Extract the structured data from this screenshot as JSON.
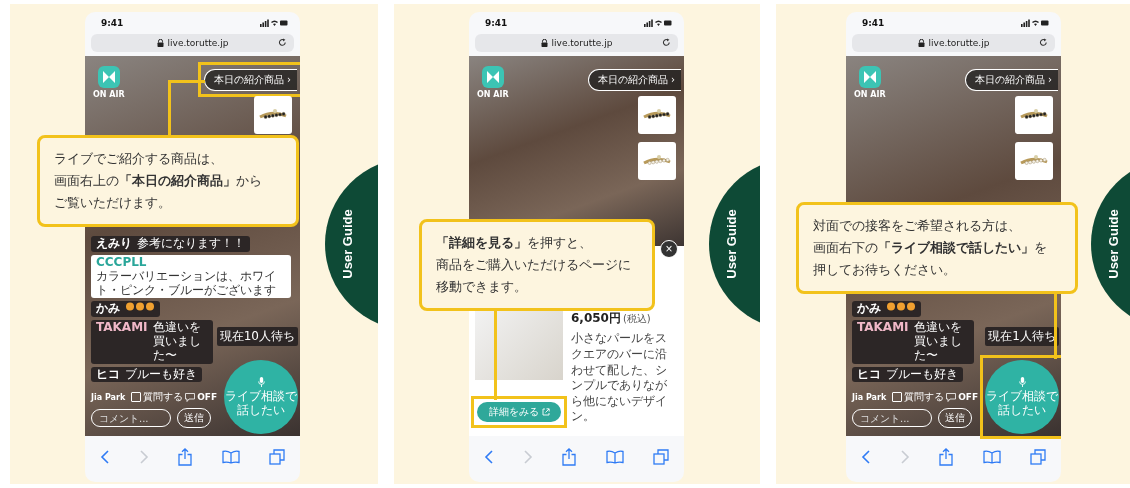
{
  "panels": [
    {
      "kind": "chat",
      "guide_label": "User Guide",
      "callout": [
        "ライブでご紹介する商品は、",
        "画面右上の**「本日の紹介商品」**から",
        "ご覧いただけます。"
      ],
      "phone": {
        "time": "9:41",
        "url": "live.torutte.jp",
        "on_air": "ON AIR",
        "products_button": {
          "label": "本日の紹介商品 ›",
          "highlighted": true
        },
        "thumbnails": [
          {
            "kind": "dark"
          }
        ],
        "messages": [
          {
            "kind": "text",
            "user": "えみり",
            "text": "参考になります！！",
            "pinned": false
          },
          {
            "kind": "text",
            "user": "CCCPLL",
            "text": "カラーバリエーションは、ホワイト・ピンク・ブルーがございます",
            "color": "#2aa69a",
            "pinned": true
          },
          {
            "kind": "reaction",
            "user": "かみ",
            "pinned": false
          },
          {
            "kind": "text",
            "user": "TAKAMI",
            "text": "色違いを買いました〜",
            "color": "#f0b8c8",
            "pinned": false
          },
          {
            "kind": "text",
            "user": "ヒコ",
            "text": "ブルーも好き",
            "pinned": false
          }
        ],
        "waiting": "現在10人待ち",
        "consult_button": {
          "lines": [
            "ライブ相談で",
            "話したい"
          ],
          "highlighted": false
        },
        "viewer": "Jia Park",
        "question_label": "質問する",
        "question_checked": false,
        "comments_toggle": "OFF",
        "comment_placeholder": "コメント...",
        "send_button": "送信"
      }
    },
    {
      "kind": "product",
      "guide_label": "User Guide",
      "callout": [
        "**「詳細を見る」**を押すと、",
        "商品をご購入いただけるページに",
        "移動できます。"
      ],
      "phone": {
        "time": "9:41",
        "url": "live.torutte.jp",
        "on_air": "ON AIR",
        "products_button": {
          "label": "本日の紹介商品 ›",
          "highlighted": false
        },
        "thumbnails": [
          {
            "kind": "dark"
          },
          {
            "kind": "pearl"
          }
        ],
        "close_button": "×",
        "price": "6,050円",
        "tax": "(税込)",
        "description": "小さなパールをスクエアのバーに沿わせて配した、シンプルでありながら他にないデザイン。",
        "details_button": {
          "label": "詳細をみる",
          "highlighted": true
        }
      }
    },
    {
      "kind": "chat",
      "guide_label": "User Guide",
      "callout": [
        "対面での接客をご希望される方は、",
        "画面右下の**「ライブ相談で話したい」**を",
        "押してお待ちください。"
      ],
      "phone": {
        "time": "9:41",
        "url": "live.torutte.jp",
        "on_air": "ON AIR",
        "products_button": {
          "label": "本日の紹介商品 ›",
          "highlighted": false
        },
        "thumbnails": [
          {
            "kind": "dark"
          },
          {
            "kind": "pearl"
          }
        ],
        "messages": [
          {
            "kind": "reaction",
            "user": "かみ",
            "pinned": false
          },
          {
            "kind": "text",
            "user": "TAKAMI",
            "text": "色違いを買いました〜",
            "color": "#f0b8c8",
            "pinned": false
          },
          {
            "kind": "text",
            "user": "ヒコ",
            "text": "ブルーも好き",
            "pinned": false
          }
        ],
        "waiting": "現在1人待ち",
        "consult_button": {
          "lines": [
            "ライブ相談で",
            "話したい"
          ],
          "highlighted": true
        },
        "viewer": "Jia Park",
        "question_label": "質問する",
        "question_checked": false,
        "comments_toggle": "OFF",
        "comment_placeholder": "コメント...",
        "send_button": "送信"
      }
    }
  ]
}
